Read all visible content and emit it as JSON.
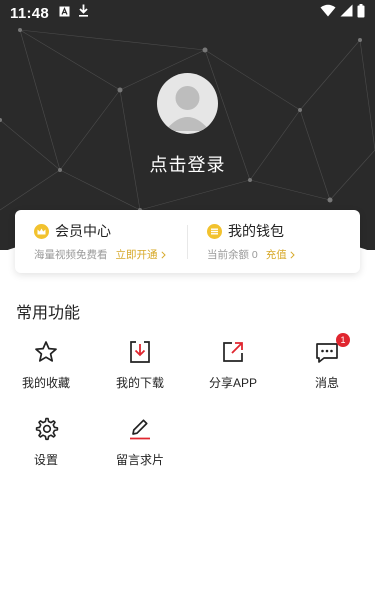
{
  "status_bar": {
    "time": "11:48"
  },
  "profile": {
    "login_text": "点击登录"
  },
  "membership": {
    "title": "会员中心",
    "subtitle": "海量视频免费看",
    "action": "立即开通"
  },
  "wallet": {
    "title": "我的钱包",
    "subtitle": "当前余额 0",
    "action": "充值"
  },
  "section": {
    "title": "常用功能"
  },
  "functions": [
    {
      "label": "我的收藏",
      "icon": "star-icon"
    },
    {
      "label": "我的下载",
      "icon": "download-icon"
    },
    {
      "label": "分享APP",
      "icon": "share-icon"
    },
    {
      "label": "消息",
      "icon": "message-icon",
      "badge": "1"
    },
    {
      "label": "设置",
      "icon": "gear-icon"
    },
    {
      "label": "留言求片",
      "icon": "edit-icon"
    }
  ],
  "colors": {
    "accent": "#d7a92a",
    "badge": "#e0262f",
    "header": "#2a2a2a"
  }
}
